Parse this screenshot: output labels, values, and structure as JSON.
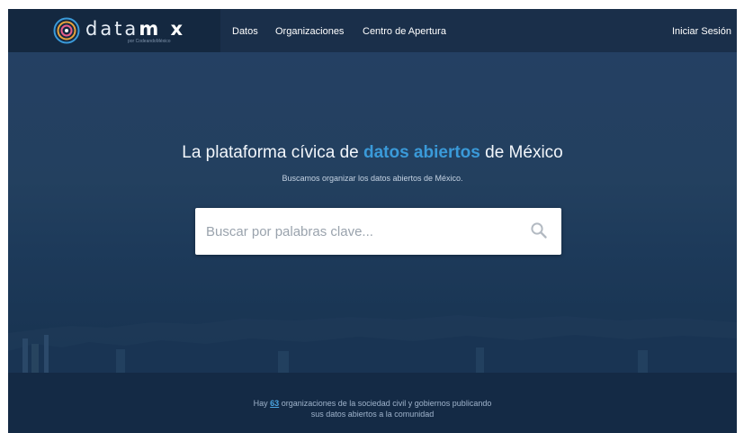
{
  "brand": {
    "logo_text_light": "data",
    "logo_text_bold": "m x",
    "logo_sub": "por CodeandoMéxico",
    "logo_icon": "concentric-circles-icon",
    "accent_color": "#3a9ad9"
  },
  "nav": {
    "items": [
      {
        "label": "Datos"
      },
      {
        "label": "Organizaciones"
      },
      {
        "label": "Centro de Apertura"
      }
    ],
    "login_label": "Iniciar Sesión"
  },
  "hero": {
    "title_before": "La plataforma cívica de ",
    "title_highlight": "datos abiertos",
    "title_after": " de México",
    "subtitle": "Buscamos organizar los datos abiertos de México."
  },
  "search": {
    "placeholder": "Buscar por palabras clave...",
    "value": "",
    "icon": "search-icon"
  },
  "stats": {
    "prefix": "Hay ",
    "count": "63",
    "suffix": " organizaciones de la sociedad civil y gobiernos publicando",
    "line2": "sus datos abiertos a la comunidad"
  }
}
